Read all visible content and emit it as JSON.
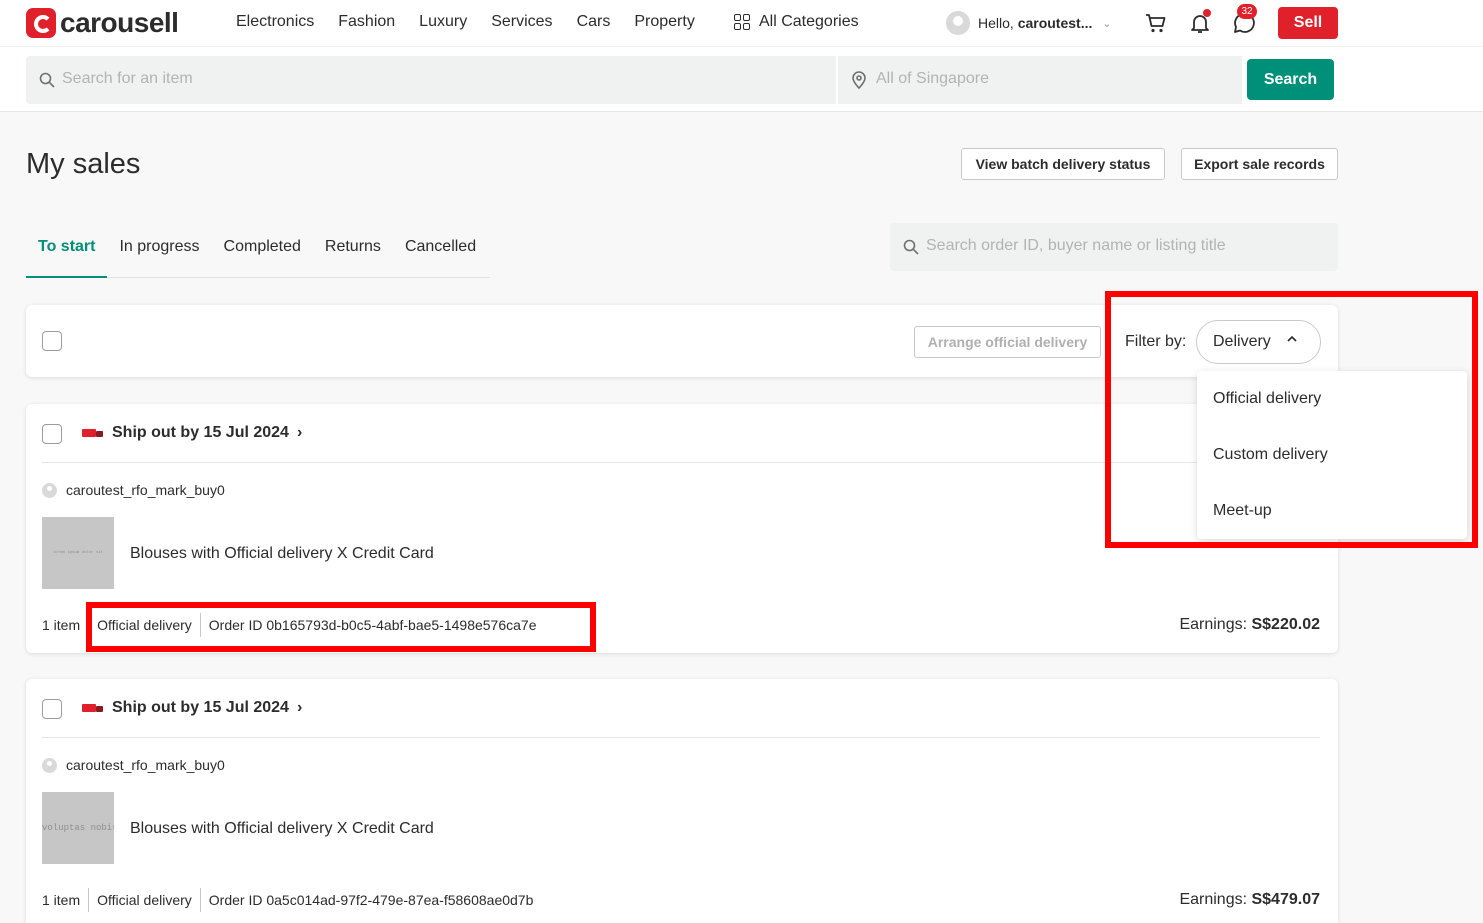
{
  "header": {
    "logo_text": "carousell",
    "nav": [
      "Electronics",
      "Fashion",
      "Luxury",
      "Services",
      "Cars",
      "Property"
    ],
    "all_categories": "All Categories",
    "greeting": "Hello,",
    "username": "caroutest...",
    "chat_badge": "32",
    "sell_label": "Sell",
    "search_placeholder": "Search for an item",
    "location_placeholder": "All of Singapore",
    "search_label": "Search"
  },
  "page": {
    "title": "My sales",
    "batch_button": "View batch delivery status",
    "export_button": "Export sale records",
    "tabs": [
      "To start",
      "In progress",
      "Completed",
      "Returns",
      "Cancelled"
    ],
    "active_tab": "To start",
    "order_search_placeholder": "Search order ID, buyer name or listing title"
  },
  "toolbar": {
    "arrange_label": "Arrange official delivery",
    "filter_label": "Filter by:",
    "filter_value": "Delivery"
  },
  "filter_menu": [
    "Official delivery",
    "Custom delivery",
    "Meet-up"
  ],
  "orders": [
    {
      "ship_by": "Ship out by 15 Jul 2024",
      "buyer": "caroutest_rfo_mark_buy0",
      "thumb_text": "lorem ipsum dolor sit",
      "listing": "Blouses with Official delivery X Credit Card",
      "items": "1 item",
      "delivery": "Official delivery",
      "order_id": "Order ID 0b165793d-b0c5-4abf-bae5-1498e576ca7e",
      "earnings_label": "Earnings:",
      "earnings": "S$220.02"
    },
    {
      "ship_by": "Ship out by 15 Jul 2024",
      "buyer": "caroutest_rfo_mark_buy0",
      "thumb_text": "voluptas nobis",
      "listing": "Blouses with Official delivery X Credit Card",
      "items": "1 item",
      "delivery": "Official delivery",
      "order_id": "Order ID 0a5c014ad-97f2-479e-87ea-f58608ae0d7b",
      "earnings_label": "Earnings:",
      "earnings": "S$479.07"
    }
  ],
  "colors": {
    "brand_red": "#e0202a",
    "accent_green": "#008f79",
    "highlight_red": "#ff0000"
  }
}
